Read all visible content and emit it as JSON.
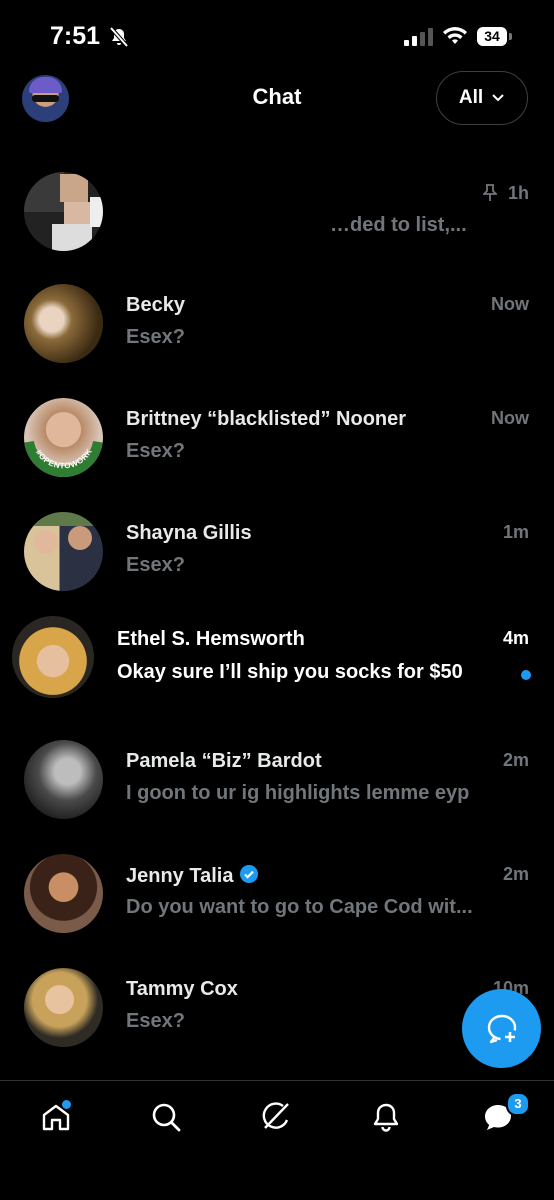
{
  "status_bar": {
    "time": "7:51",
    "battery": "34"
  },
  "header": {
    "title": "Chat",
    "filter_label": "All"
  },
  "conversations": [
    {
      "name": "",
      "preview": "…ded to list,...",
      "time": "1h",
      "pinned": true
    },
    {
      "name": "Becky",
      "preview": "Esex?",
      "time": "Now"
    },
    {
      "name": "Brittney “blacklisted” Nooner",
      "preview": "Esex?",
      "time": "Now",
      "avatar_ring_text": "#OPENTOWORK"
    },
    {
      "name": "Shayna Gillis",
      "preview": "Esex?",
      "time": "1m"
    },
    {
      "name": "Ethel S. Hemsworth",
      "preview": "Okay sure I’ll ship you socks for $50",
      "time": "4m",
      "unread": true
    },
    {
      "name": "Pamela “Biz” Bardot",
      "preview": "I goon to ur ig highlights lemme eyp",
      "time": "2m"
    },
    {
      "name": "Jenny Talia",
      "preview": "Do you want to go to Cape Cod wit...",
      "time": "2m",
      "verified": true
    },
    {
      "name": "Tammy Cox",
      "preview": "Esex?",
      "time": "10m"
    }
  ],
  "tabbar": {
    "items": [
      "home-icon",
      "search-icon",
      "grok-icon",
      "notifications-icon",
      "messages-icon"
    ],
    "messages_badge": "3"
  },
  "colors": {
    "accent": "#1d9bf0",
    "background": "#000000",
    "secondary_text": "#71767b"
  }
}
